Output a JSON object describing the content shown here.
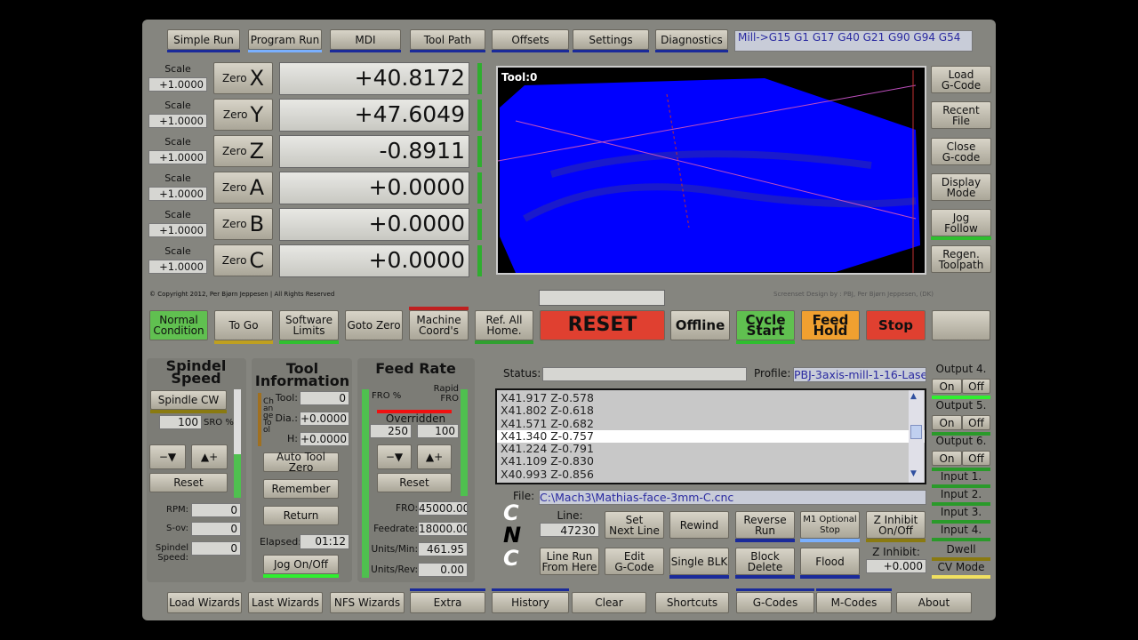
{
  "tabs": [
    "Simple Run",
    "Program Run",
    "MDI",
    "Tool Path",
    "Offsets",
    "Settings",
    "Diagnostics"
  ],
  "gcode_modes": "Mill->G15  G1 G17 G40 G21 G90 G94 G54",
  "dro": [
    {
      "axis": "X",
      "scale": "+1.0000",
      "value": "+40.8172"
    },
    {
      "axis": "Y",
      "scale": "+1.0000",
      "value": "+47.6049"
    },
    {
      "axis": "Z",
      "scale": "+1.0000",
      "value": "-0.8911"
    },
    {
      "axis": "A",
      "scale": "+1.0000",
      "value": "+0.0000"
    },
    {
      "axis": "B",
      "scale": "+1.0000",
      "value": "+0.0000"
    },
    {
      "axis": "C",
      "scale": "+1.0000",
      "value": "+0.0000"
    }
  ],
  "scale_label": "Scale",
  "zero_label": "Zero",
  "copyright": "© Copyright 2012, Per Bjørn Jeppesen | All Rights Reserved",
  "design_credit": "Screenset Design by : PBJ, Per Bjørn Jeppesen, (DK)",
  "toolpath": {
    "tool_label": "Tool:0",
    "bg": "#0000ff"
  },
  "right_buttons": [
    "Load\nG-Code",
    "Recent\nFile",
    "Close\nG-code",
    "Display\nMode",
    "Jog\nFollow",
    "Regen.\nToolpath"
  ],
  "mid_buttons": [
    "Normal\nCondition",
    "To Go",
    "Software\nLimits",
    "Goto Zero",
    "Machine\nCoord's",
    "Ref. All\nHome.",
    "RESET",
    "Offline",
    "Cycle\nStart",
    "Feed\nHold",
    "Stop",
    ""
  ],
  "spindle": {
    "title": "Spindel\nSpeed",
    "cw": "Spindle CW",
    "sro": "100",
    "sro_label": "SRO %",
    "reset": "Reset",
    "rpm_label": "RPM:",
    "rpm": "0",
    "sov_label": "S-ov:",
    "sov": "0",
    "speed_label": "Spindel\nSpeed:",
    "speed": "0"
  },
  "tool": {
    "title": "Tool\nInformation",
    "change": "Change Tool",
    "tool_label": "Tool:",
    "tool": "0",
    "dia_label": "Dia.:",
    "dia": "+0.0000",
    "h_label": "H:",
    "h": "+0.0000",
    "auto_zero": "Auto Tool Zero",
    "remember": "Remember",
    "return": "Return",
    "elapsed_label": "Elapsed:",
    "elapsed": "01:12",
    "jog": "Jog On/Off"
  },
  "feed": {
    "title": "Feed Rate",
    "fro_pct": "FRO %",
    "rapid": "Rapid\nFRO",
    "overridden": "Overridden",
    "fro_val": "250",
    "rapid_val": "100",
    "reset": "Reset",
    "fro_label": "FRO:",
    "fro": "45000.00",
    "feedrate_label": "Feedrate:",
    "feedrate": "18000.00",
    "upm_label": "Units/Min:",
    "upm": "461.95",
    "upr_label": "Units/Rev:",
    "upr": "0.00"
  },
  "status_label": "Status:",
  "status": "",
  "profile_label": "Profile:",
  "profile": "PBJ-3axis-mill-1-16-Lase",
  "gcode_lines": [
    "X41.917  Z-0.578",
    "X41.802  Z-0.618",
    "X41.571  Z-0.682",
    "X41.340  Z-0.757",
    "X41.224  Z-0.791",
    "X41.109  Z-0.830",
    "X40.993  Z-0.856"
  ],
  "file_label": "File:",
  "file": "C:\\Mach3\\Mathias-face-3mm-C.cnc",
  "logo": [
    "C",
    "N",
    "C"
  ],
  "line_label": "Line:",
  "line": "47230",
  "prog_buttons": [
    "Set\nNext Line",
    "Rewind",
    "Reverse\nRun",
    "M1 Optional\nStop",
    "Z Inhibit\nOn/Off",
    "Line Run\nFrom Here",
    "Edit\nG-Code",
    "Single BLK",
    "Block\nDelete",
    "Flood"
  ],
  "z_inhibit_label": "Z Inhibit:",
  "z_inhibit": "+0.000",
  "outputs": [
    "Output 4.",
    "Output 5.",
    "Output 6."
  ],
  "on": "On",
  "off": "Off",
  "leds": [
    "Input 1.",
    "Input 2.",
    "Input 3.",
    "Input 4.",
    "Dwell",
    "CV Mode"
  ],
  "bottom_tabs": [
    "Load Wizards",
    "Last Wizards",
    "NFS Wizards",
    "Extra",
    "History",
    "Clear",
    "Shortcuts",
    "G-Codes",
    "M-Codes",
    "About"
  ]
}
